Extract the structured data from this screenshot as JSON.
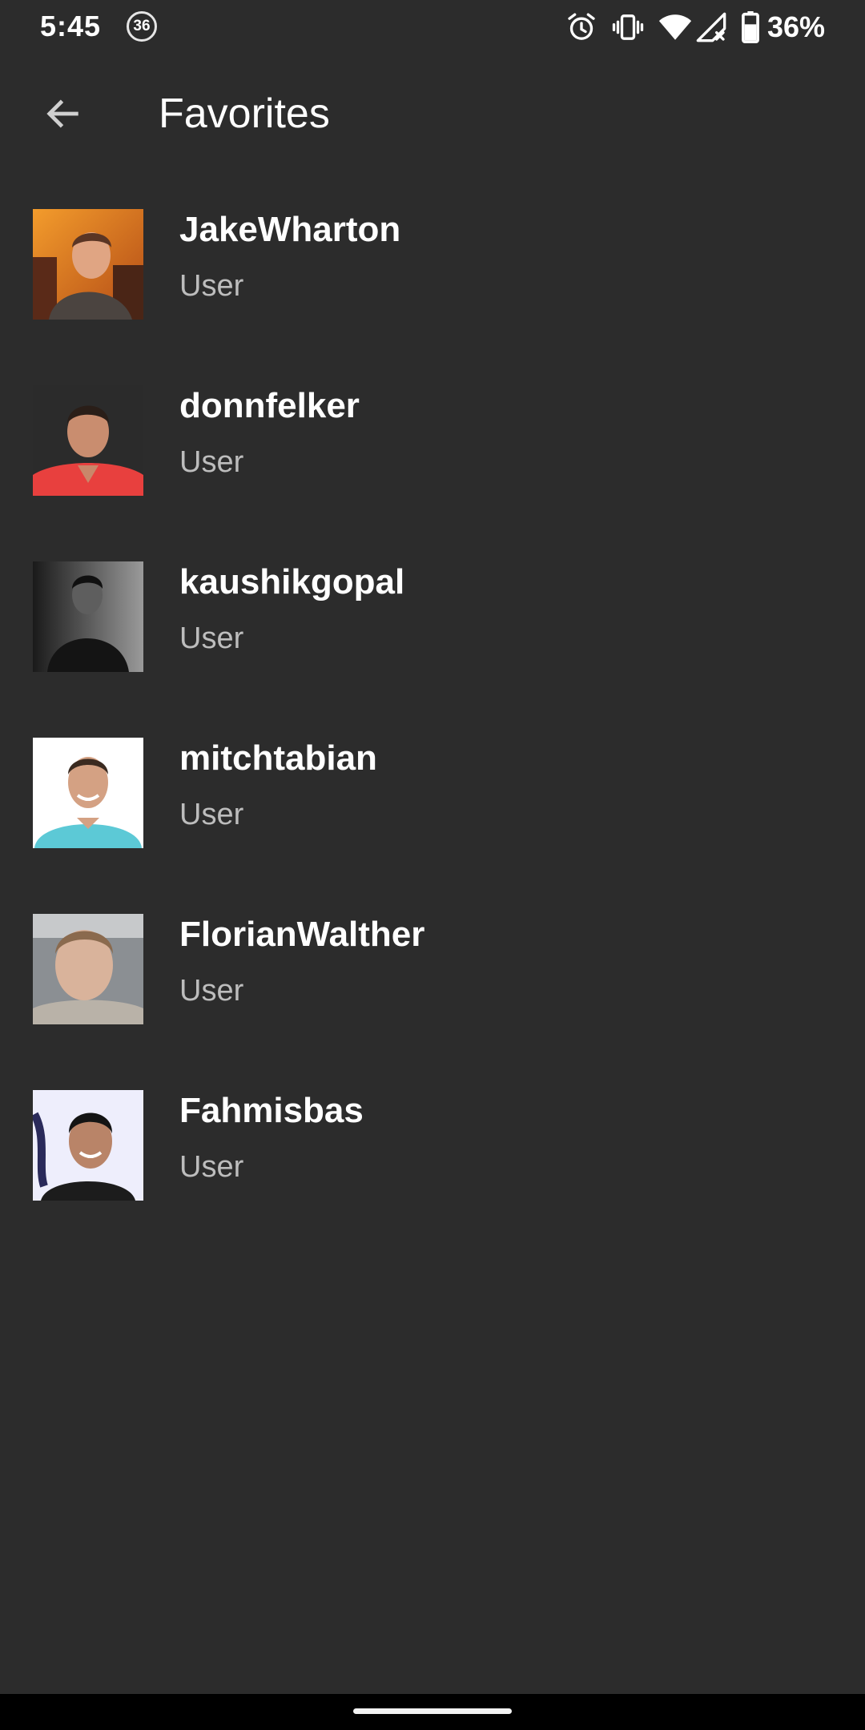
{
  "status_bar": {
    "time": "5:45",
    "notification_badge": "36",
    "battery_text": "36%",
    "icons": [
      "alarm-icon",
      "vibrate-icon",
      "wifi-icon",
      "cellular-no-signal-icon",
      "battery-icon"
    ]
  },
  "app_bar": {
    "back_icon": "arrow-back-icon",
    "title": "Favorites"
  },
  "users": [
    {
      "name": "JakeWharton",
      "type": "User"
    },
    {
      "name": "donnfelker",
      "type": "User"
    },
    {
      "name": "kaushikgopal",
      "type": "User"
    },
    {
      "name": "mitchtabian",
      "type": "User"
    },
    {
      "name": "FlorianWalther",
      "type": "User"
    },
    {
      "name": "Fahmisbas",
      "type": "User"
    }
  ],
  "colors": {
    "background": "#2c2c2c",
    "primary_text": "#ffffff",
    "secondary_text": "#bdbdbd",
    "nav_bar": "#000000"
  }
}
